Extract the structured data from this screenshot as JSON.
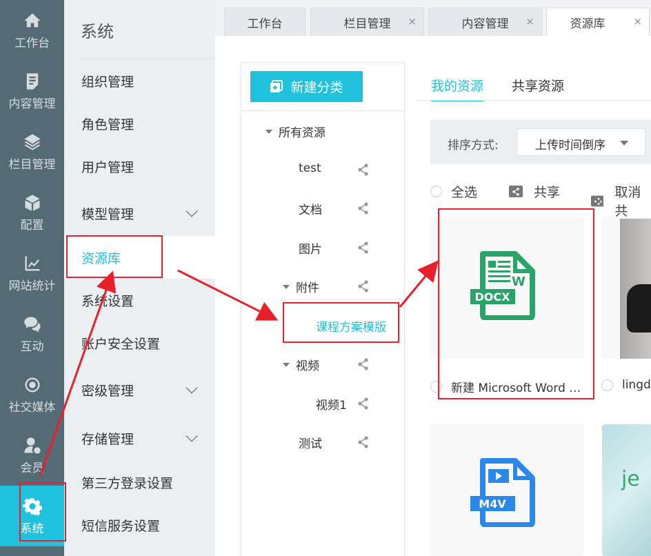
{
  "rail": [
    {
      "label": "工作台",
      "icon": "home-icon"
    },
    {
      "label": "内容管理",
      "icon": "document-icon"
    },
    {
      "label": "栏目管理",
      "icon": "layers-icon"
    },
    {
      "label": "配置",
      "icon": "cube-icon"
    },
    {
      "label": "网站统计",
      "icon": "chart-icon"
    },
    {
      "label": "互动",
      "icon": "chat-icon"
    },
    {
      "label": "社交媒体",
      "icon": "social-icon"
    },
    {
      "label": "会员",
      "icon": "member-icon"
    },
    {
      "label": "系统",
      "icon": "gear-icon"
    }
  ],
  "menu": {
    "title": "系统",
    "items": [
      "组织管理",
      "角色管理",
      "用户管理",
      "模型管理",
      "资源库",
      "系统设置",
      "账户安全设置",
      "密级管理",
      "存储管理",
      "第三方登录设置",
      "短信服务设置"
    ]
  },
  "tabs": [
    {
      "label": "工作台"
    },
    {
      "label": "栏目管理",
      "close": "×"
    },
    {
      "label": "内容管理",
      "close": "×"
    },
    {
      "label": "资源库",
      "close": "×"
    }
  ],
  "tree": {
    "new_button": "新建分类",
    "nodes": [
      "所有资源",
      "test",
      "文档",
      "图片",
      "附件",
      "课程方案模版",
      "视频",
      "视频1",
      "测试"
    ]
  },
  "resource_tabs": [
    "我的资源",
    "共享资源"
  ],
  "sort": {
    "label": "排序方式:",
    "value": "上传时间倒序"
  },
  "actions": {
    "select_all": "全选",
    "share": "共享",
    "unshare": "取消共"
  },
  "files": [
    {
      "name": "新建 Microsoft Word …",
      "badge": "DOCX",
      "mark": "W"
    },
    {
      "name": "lingda"
    },
    {
      "badge": "M4V"
    },
    {
      "text": "je"
    }
  ],
  "colors": {
    "accent": "#1fc1dc",
    "rail": "#546a74",
    "annotation": "#e8202a",
    "docx": "#2aa36b",
    "m4v": "#2b88e8"
  }
}
